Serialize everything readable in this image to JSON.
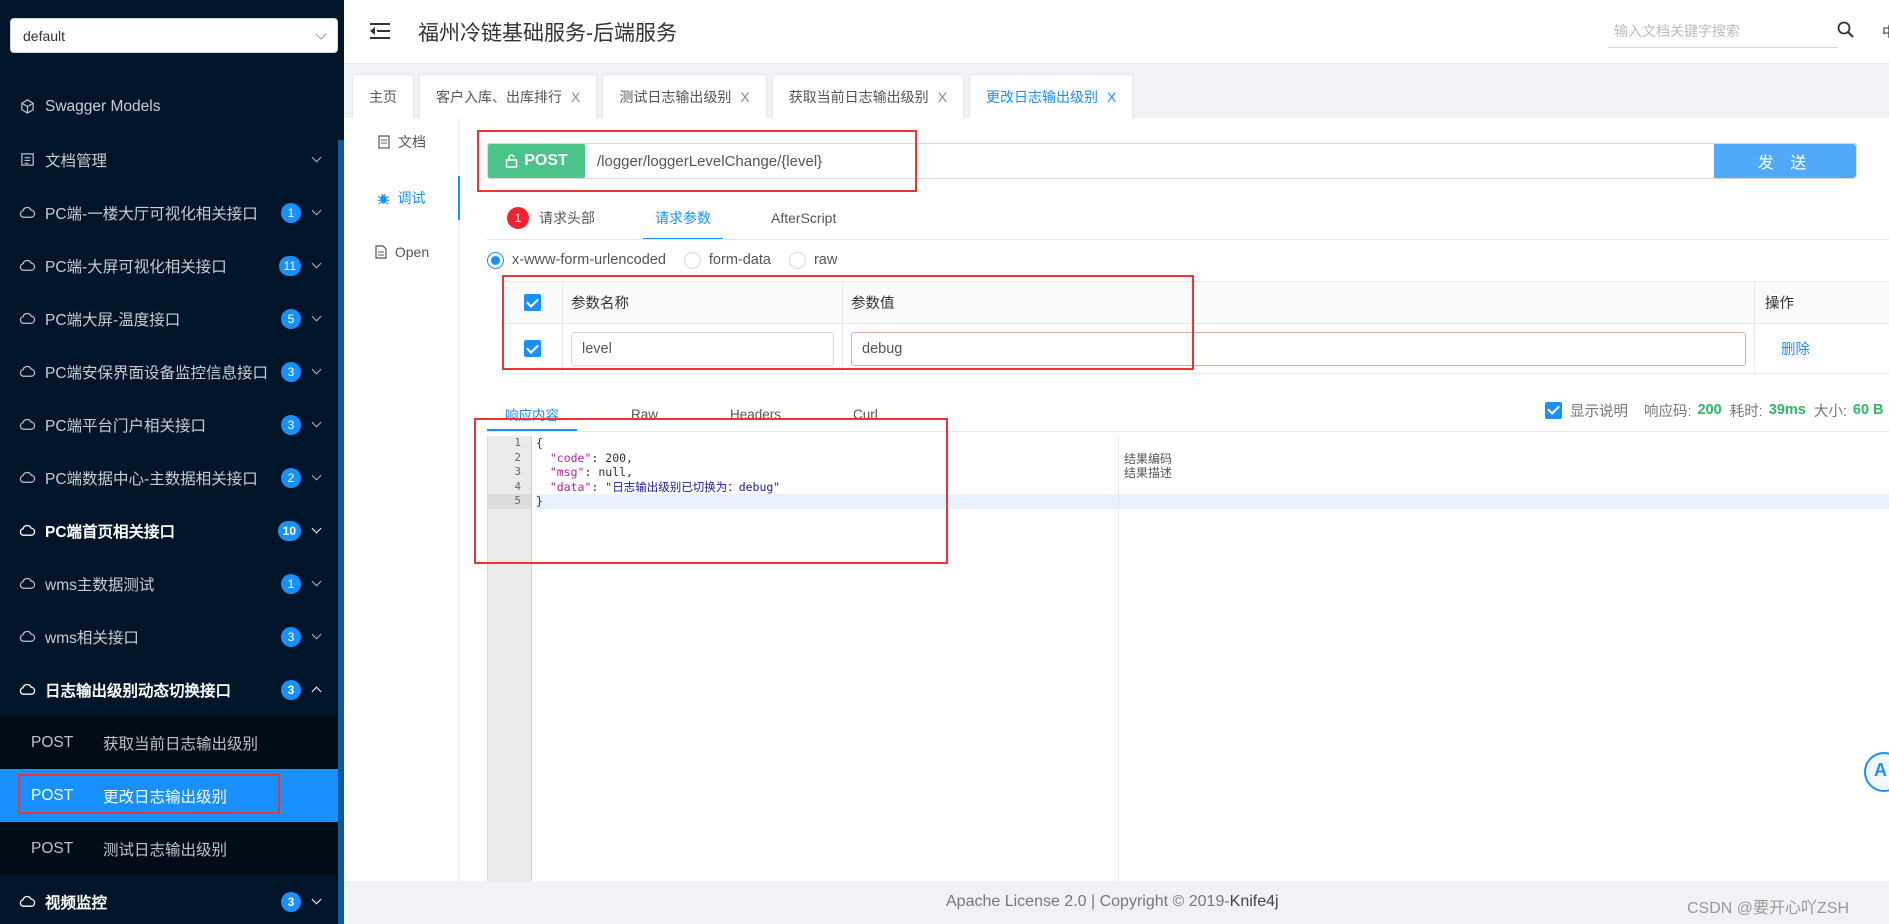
{
  "sidebar": {
    "group_select": "default",
    "items": [
      {
        "label": "Swagger Models",
        "badge": "",
        "icon": "cube-icon",
        "chevron": false
      },
      {
        "label": "文档管理",
        "badge": "",
        "icon": "folder-icon",
        "chevron": true
      },
      {
        "label": "PC端-一楼大厅可视化相关接口",
        "badge": "1",
        "icon": "cloud-icon",
        "chevron": true
      },
      {
        "label": "PC端-大屏可视化相关接口",
        "badge": "11",
        "icon": "cloud-icon",
        "chevron": true
      },
      {
        "label": "PC端大屏-温度接口",
        "badge": "5",
        "icon": "cloud-icon",
        "chevron": true
      },
      {
        "label": "PC端安保界面设备监控信息接口",
        "badge": "3",
        "icon": "cloud-icon",
        "chevron": true
      },
      {
        "label": "PC端平台门户相关接口",
        "badge": "3",
        "icon": "cloud-icon",
        "chevron": true
      },
      {
        "label": "PC端数据中心-主数据相关接口",
        "badge": "2",
        "icon": "cloud-icon",
        "chevron": true
      },
      {
        "label": "PC端首页相关接口",
        "badge": "10",
        "icon": "cloud-icon",
        "chevron": true
      },
      {
        "label": "wms主数据测试",
        "badge": "1",
        "icon": "cloud-icon",
        "chevron": true
      },
      {
        "label": "wms相关接口",
        "badge": "3",
        "icon": "cloud-icon",
        "chevron": true
      },
      {
        "label": "日志输出级别动态切换接口",
        "badge": "3",
        "icon": "cloud-icon",
        "chevron": true
      }
    ],
    "sub_items": [
      {
        "method": "POST",
        "label": "获取当前日志输出级别"
      },
      {
        "method": "POST",
        "label": "更改日志输出级别"
      },
      {
        "method": "POST",
        "label": "测试日志输出级别"
      }
    ],
    "last_item": {
      "label": "视频监控",
      "badge": "3",
      "icon": "cloud-icon"
    }
  },
  "header": {
    "title": "福州冷链基础服务-后端服务",
    "search_placeholder": "输入文档关键字搜索",
    "lang": "中"
  },
  "tabs": [
    {
      "label": "主页",
      "closable": false
    },
    {
      "label": "客户入库、出库排行",
      "closable": true
    },
    {
      "label": "测试日志输出级别",
      "closable": true
    },
    {
      "label": "获取当前日志输出级别",
      "closable": true
    },
    {
      "label": "更改日志输出级别",
      "closable": true,
      "active": true
    }
  ],
  "doc_nav": [
    {
      "label": "文档",
      "icon": "doc-icon"
    },
    {
      "label": "调试",
      "icon": "bug-icon",
      "active": true
    },
    {
      "label": "Open",
      "icon": "file-icon"
    }
  ],
  "request": {
    "method": "POST",
    "url": "/logger/loggerLevelChange/{level}",
    "send_label": "发 送",
    "tabs": {
      "headers": "请求头部",
      "headers_count": "1",
      "params": "请求参数",
      "afterscript": "AfterScript"
    },
    "content_types": [
      "x-www-form-urlencoded",
      "form-data",
      "raw"
    ],
    "table": {
      "col_name": "参数名称",
      "col_value": "参数值",
      "col_op": "操作",
      "row": {
        "name": "level",
        "value": "debug",
        "op": "删除"
      }
    }
  },
  "response": {
    "tabs": [
      "响应内容",
      "Raw",
      "Headers",
      "Curl"
    ],
    "show_desc_label": "显示说明",
    "code_label": "响应码:",
    "code": "200",
    "time_label": "耗时:",
    "time": "39ms",
    "size_label": "大小:",
    "size": "60 B",
    "lines": [
      "1",
      "2",
      "3",
      "4",
      "5"
    ],
    "body": {
      "open": "{",
      "code_key": "\"code\"",
      "code_val": "200,",
      "msg_key": "\"msg\"",
      "msg_val": "null,",
      "data_key": "\"data\"",
      "data_val": "\"日志输出级别已切换为：debug\"",
      "close": "}"
    },
    "desc": [
      "结果编码",
      "结果描述"
    ]
  },
  "footer": {
    "text": "Apache License 2.0 | Copyright © 2019-",
    "brand": "Knife4j",
    "watermark": "CSDN @要开心吖ZSH"
  }
}
